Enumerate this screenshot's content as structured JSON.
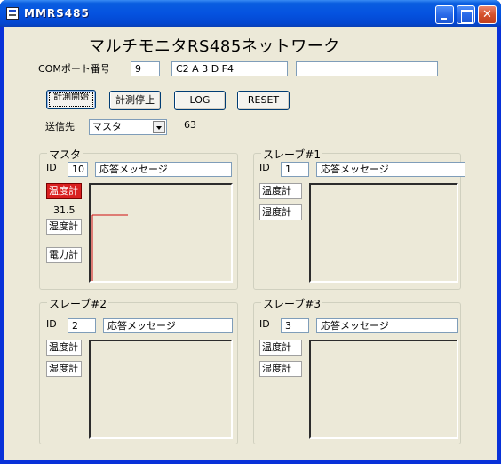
{
  "window": {
    "title": "MMRS485"
  },
  "heading": "マルチモニタRS485ネットワーク",
  "com": {
    "label": "COMポート番号",
    "port": "9",
    "data": "C2 A 3 D F4",
    "extra": ""
  },
  "buttons": {
    "start": "計測開始",
    "stop": "計測停止",
    "log": "LOG",
    "reset": "RESET"
  },
  "dest": {
    "label": "送信先",
    "value": "マスタ",
    "count": "63"
  },
  "panels": [
    {
      "title": "マスタ",
      "id_label": "ID",
      "id": "10",
      "message": "応答メッセージ",
      "sensors": [
        "温度計",
        "湿度計",
        "電力計"
      ],
      "temp_value": "31.5",
      "alert_sensor": "温度計",
      "alert_color": "#d92020",
      "trace": {
        "value": 31.5,
        "color": "#d01010"
      }
    },
    {
      "title": "スレーブ#1",
      "id_label": "ID",
      "id": "1",
      "message": "応答メッセージ",
      "sensors": [
        "温度計",
        "湿度計"
      ]
    },
    {
      "title": "スレーブ#2",
      "id_label": "ID",
      "id": "2",
      "message": "応答メッセージ",
      "sensors": [
        "温度計",
        "湿度計"
      ]
    },
    {
      "title": "スレーブ#3",
      "id_label": "ID",
      "id": "3",
      "message": "応答メッセージ",
      "sensors": [
        "温度計",
        "湿度計"
      ]
    }
  ]
}
